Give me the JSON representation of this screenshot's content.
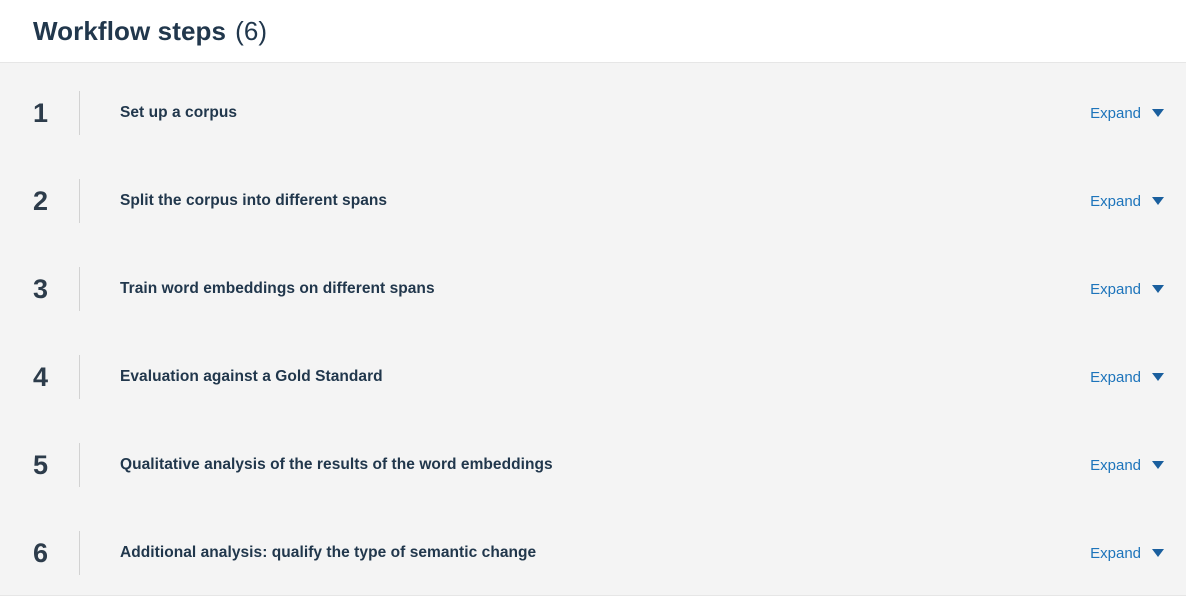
{
  "header": {
    "title": "Workflow steps",
    "count": "(6)"
  },
  "colors": {
    "panel_background": "#ffffff",
    "steps_background": "#f4f4f4",
    "title_text": "#21374c",
    "step_number": "#2d3c4b",
    "link": "#1d74bb",
    "divider": "#d2d2d2",
    "border": "#e6e6e6"
  },
  "steps": [
    {
      "number": "1",
      "title": "Set up a corpus",
      "expand_label": "Expand",
      "expand_icon": "chevron-down-icon"
    },
    {
      "number": "2",
      "title": "Split the corpus into different spans",
      "expand_label": "Expand",
      "expand_icon": "chevron-down-icon"
    },
    {
      "number": "3",
      "title": "Train word embeddings on different spans",
      "expand_label": "Expand",
      "expand_icon": "chevron-down-icon"
    },
    {
      "number": "4",
      "title": "Evaluation against a Gold Standard",
      "expand_label": "Expand",
      "expand_icon": "chevron-down-icon"
    },
    {
      "number": "5",
      "title": "Qualitative analysis of the results of the word embeddings",
      "expand_label": "Expand",
      "expand_icon": "chevron-down-icon"
    },
    {
      "number": "6",
      "title": "Additional analysis: qualify the type of semantic change",
      "expand_label": "Expand",
      "expand_icon": "chevron-down-icon"
    }
  ]
}
